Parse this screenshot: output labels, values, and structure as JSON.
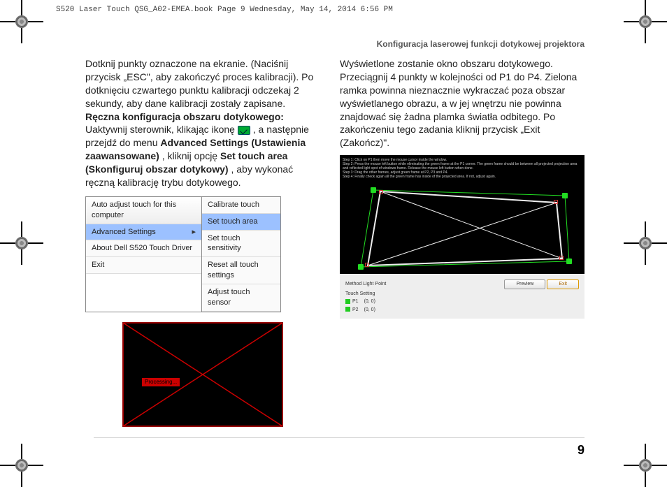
{
  "bookmeta": "S520 Laser Touch QSG_A02-EMEA.book  Page 9  Wednesday, May 14, 2014  6:56 PM",
  "running_head": "Konfiguracja laserowej funkcji dotykowej projektora",
  "page_number": "9",
  "left": {
    "p1": "Dotknij punkty oznaczone na ekranie. (Naciśnij przycisk „ESC\", aby zakończyć proces kalibracji). Po dotknięciu czwartego punktu kalibracji odczekaj 2 sekundy, aby dane kalibracji zostały zapisane.",
    "h1": "Ręczna konfiguracja obszaru dotykowego:",
    "p2a": "Uaktywnij sterownik, klikając ikonę ",
    "p2b": ", a następnie przejdź do menu ",
    "bold1": "Advanced Settings (Ustawienia zaawansowane)",
    "p2c": ", kliknij opcję ",
    "bold2": "Set touch area (Skonfiguruj obszar dotykowy)",
    "p2d": ", aby wykonać ręczną kalibrację trybu dotykowego.",
    "menu_left": [
      "Auto adjust touch for this computer",
      "Advanced Settings",
      "About Dell S520 Touch Driver",
      "Exit"
    ],
    "menu_right": [
      "Calibrate touch",
      "Set touch area",
      "Set touch sensitivity",
      "Reset all touch settings",
      "Adjust touch sensor"
    ],
    "warn_label": "Processing..."
  },
  "right": {
    "p1": "Wyświetlone zostanie okno obszaru dotykowego.",
    "p2": "Przeciągnij 4 punkty w kolejności od P1 do P4. Zielona ramka powinna nieznacznie wykraczać poza obszar wyświetlanego obrazu, a w jej wnętrzu nie powinna znajdować się żadna plamka światła odbitego. Po zakończeniu tego zadania kliknij przycisk „Exit (Zakończ)\".",
    "instr": "Step 1: Click on P1 then move the mouse cursor inside the window.\nStep 2: Press the mouse left button while eliminating the green frame at the P1 corner. The green frame should be between all projected projection area and reflected light spot of windows frame. Release the mouse left button when done.\nStep 3: Drag the other frames, adjust green frame at P2, P3 and P4.\nStep 4: Finally check again all the green frame has inside of the projected area. If not, adjust again.",
    "panel": {
      "title": "Method Light Point",
      "section": "Touch Setting",
      "p1_lbl": "P1",
      "p1_val": "(0, 0)",
      "p2_lbl": "P2",
      "p2_val": "(0, 0)",
      "btn_preview": "Preview",
      "btn_exit": "Exit"
    }
  }
}
